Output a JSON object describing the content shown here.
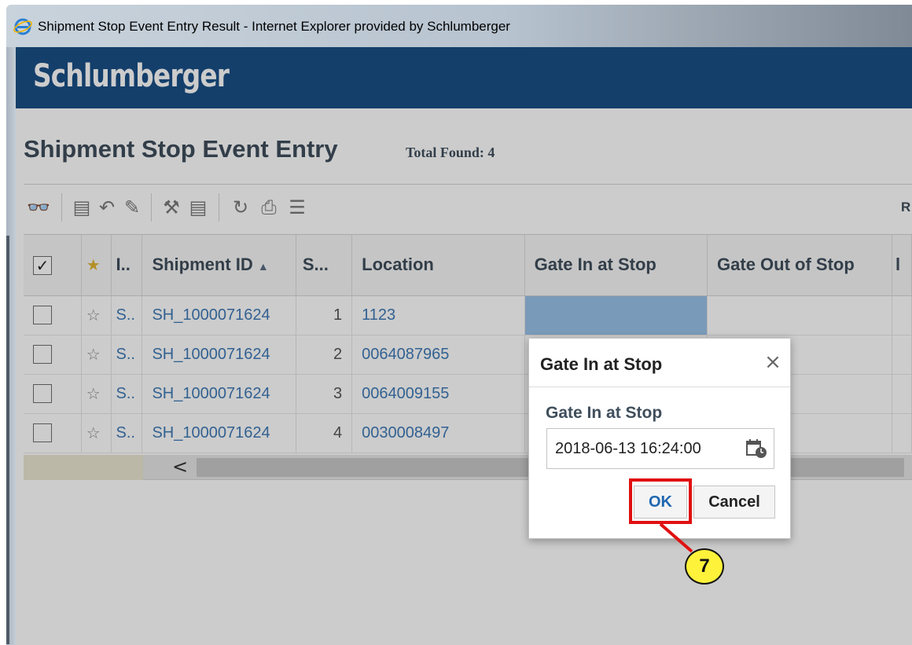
{
  "window": {
    "title": "Shipment Stop Event Entry Result - Internet Explorer provided by Schlumberger"
  },
  "brand": {
    "name": "Schlumberger"
  },
  "page": {
    "title": "Shipment Stop Event Entry",
    "total_found_label": "Total Found:",
    "total_found_value": "4"
  },
  "toolbar": {
    "icons": [
      "view-icon",
      "save-icon",
      "undo-icon",
      "edit-icon",
      "tools-icon",
      "save-all-icon",
      "refresh-icon",
      "print-icon",
      "columns-icon"
    ],
    "right_label": "R"
  },
  "grid": {
    "columns": [
      "",
      "",
      "I..",
      "Shipment ID",
      "S...",
      "Location",
      "Gate In at Stop",
      "Gate Out of Stop",
      "l"
    ],
    "sort_indicator": "▲",
    "rows": [
      {
        "i": "S..",
        "shipment_id": "SH_1000071624",
        "stop": "1",
        "location": "1123"
      },
      {
        "i": "S..",
        "shipment_id": "SH_1000071624",
        "stop": "2",
        "location": "0064087965"
      },
      {
        "i": "S..",
        "shipment_id": "SH_1000071624",
        "stop": "3",
        "location": "0064009155"
      },
      {
        "i": "S..",
        "shipment_id": "SH_1000071624",
        "stop": "4",
        "location": "0030008497"
      }
    ],
    "scroll_left_arrow": "<"
  },
  "dialog": {
    "title": "Gate In at Stop",
    "close_glyph": "×",
    "field_label": "Gate In at Stop",
    "field_value": "2018-06-13 16:24:00",
    "ok_label": "OK",
    "cancel_label": "Cancel"
  },
  "annotation": {
    "step": "7"
  },
  "colors": {
    "brand_bar": "#1a4f86",
    "link_blue": "#3f7ab6",
    "selected_cell": "#99c1e8",
    "highlight_red": "#e01010",
    "callout_yellow": "#fff23a"
  }
}
